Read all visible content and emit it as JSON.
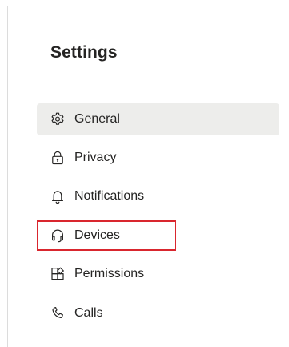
{
  "settings": {
    "title": "Settings",
    "items": [
      {
        "label": "General",
        "icon": "gear-icon",
        "selected": true
      },
      {
        "label": "Privacy",
        "icon": "lock-icon",
        "selected": false
      },
      {
        "label": "Notifications",
        "icon": "bell-icon",
        "selected": false
      },
      {
        "label": "Devices",
        "icon": "headset-icon",
        "selected": false,
        "highlighted": true
      },
      {
        "label": "Permissions",
        "icon": "apps-icon",
        "selected": false
      },
      {
        "label": "Calls",
        "icon": "phone-icon",
        "selected": false
      }
    ]
  },
  "colors": {
    "selected_background": "#ededeb",
    "highlight_border": "#d9262e",
    "text": "#252423"
  }
}
